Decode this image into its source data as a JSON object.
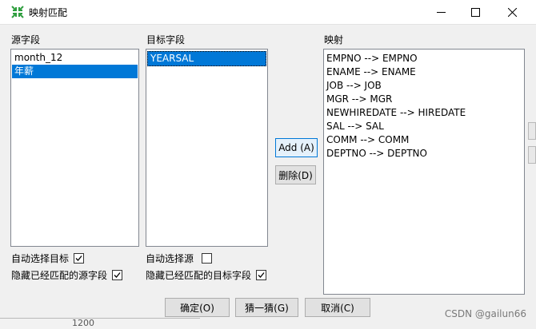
{
  "window": {
    "title": "映射匹配"
  },
  "source": {
    "label": "源字段",
    "items": [
      "month_12",
      "年薪"
    ],
    "selected_index": 1
  },
  "target": {
    "label": "目标字段",
    "items": [
      "YEARSAL"
    ],
    "selected_index": 0
  },
  "mapping": {
    "label": "映射",
    "items": [
      "EMPNO --> EMPNO",
      "ENAME --> ENAME",
      "JOB --> JOB",
      "MGR --> MGR",
      "NEWHIREDATE --> HIREDATE",
      "SAL --> SAL",
      "COMM --> COMM",
      "DEPTNO --> DEPTNO"
    ]
  },
  "buttons": {
    "add": "Add (A)",
    "delete": "删除(D)",
    "ok": "确定(O)",
    "guess": "猜一猜(G)",
    "cancel": "取消(C)"
  },
  "options": {
    "auto_select_target": {
      "label": "自动选择目标",
      "checked": true
    },
    "hide_matched_source": {
      "label": "隐藏已经匹配的源字段",
      "checked": true
    },
    "auto_select_source": {
      "label": "自动选择源",
      "checked": false
    },
    "hide_matched_target": {
      "label": "隐藏已经匹配的目标字段",
      "checked": true
    }
  },
  "background_fragments": {
    "bottom_left_number": "1200"
  },
  "watermark": "CSDN @gailun66",
  "colors": {
    "selection": "#0078d7",
    "window_bg": "#f0f0f0"
  }
}
